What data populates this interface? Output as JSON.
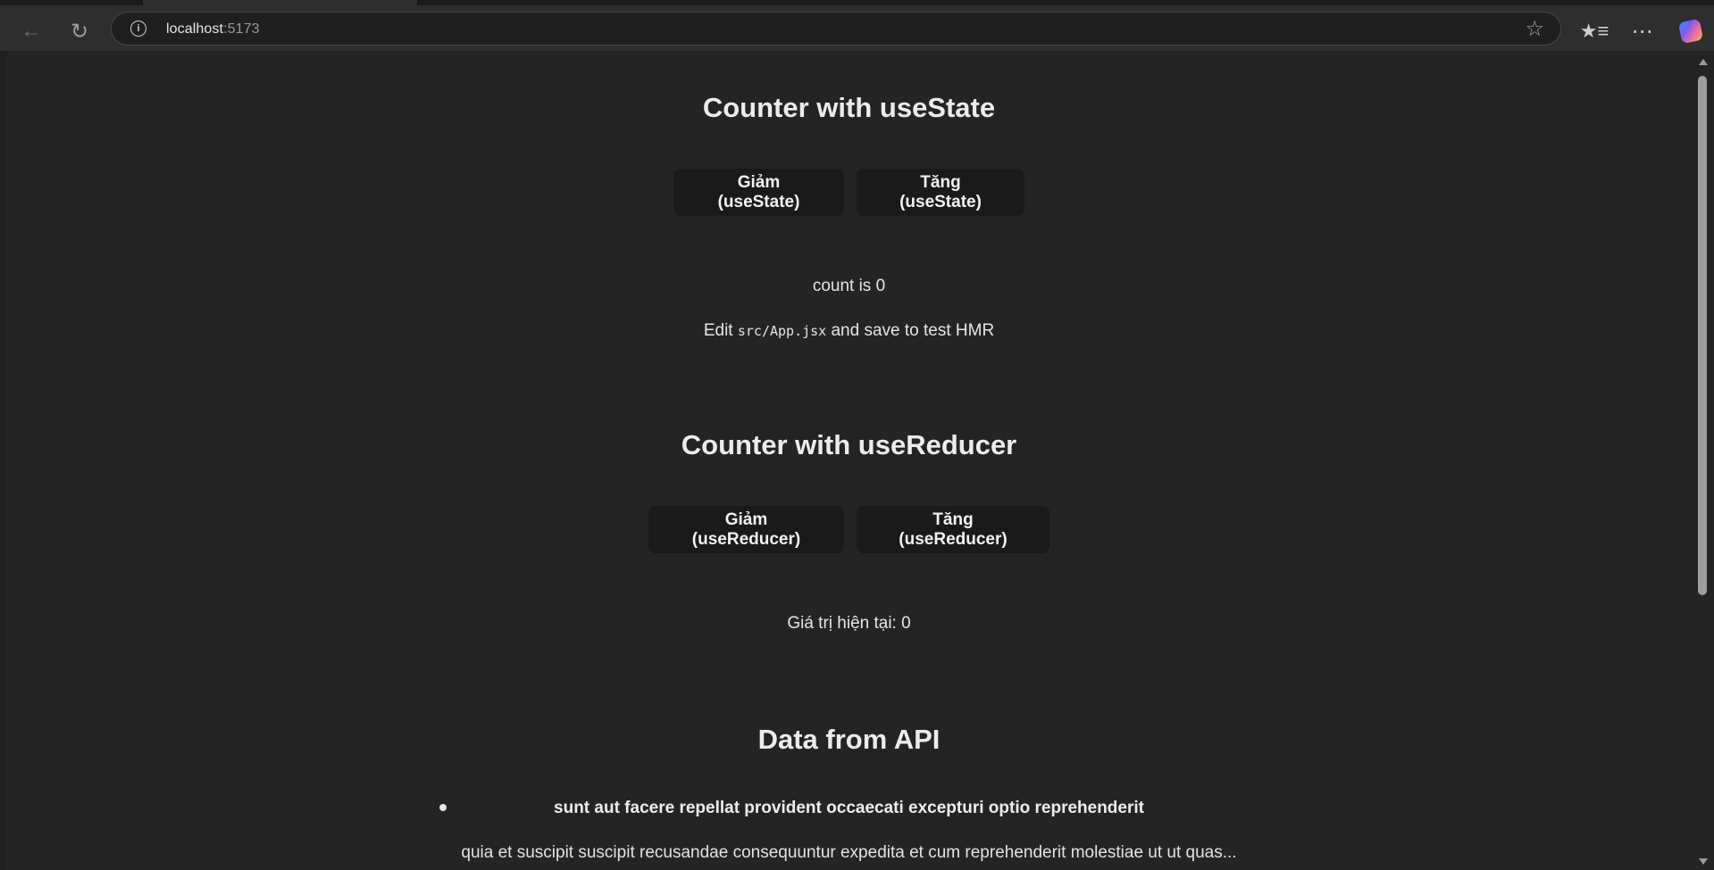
{
  "browser": {
    "url_host": "localhost",
    "url_port": ":5173"
  },
  "use_state_section": {
    "title": "Counter with useState",
    "decrement_label": "Giảm (useState)",
    "increment_label": "Tăng (useState)",
    "count_text": "count is 0",
    "edit_prefix": "Edit ",
    "edit_code": "src/App.jsx",
    "edit_suffix": " and save to test HMR"
  },
  "use_reducer_section": {
    "title": "Counter with useReducer",
    "decrement_label": "Giảm (useReducer)",
    "increment_label": "Tăng (useReducer)",
    "value_text": "Giá trị hiện tại: 0"
  },
  "api_section": {
    "title": "Data from API",
    "posts": [
      {
        "title": "sunt aut facere repellat provident occaecati excepturi optio reprehenderit",
        "body": "quia et suscipit suscipit recusandae consequuntur expedita et cum reprehenderit molestiae ut ut quas..."
      }
    ]
  }
}
